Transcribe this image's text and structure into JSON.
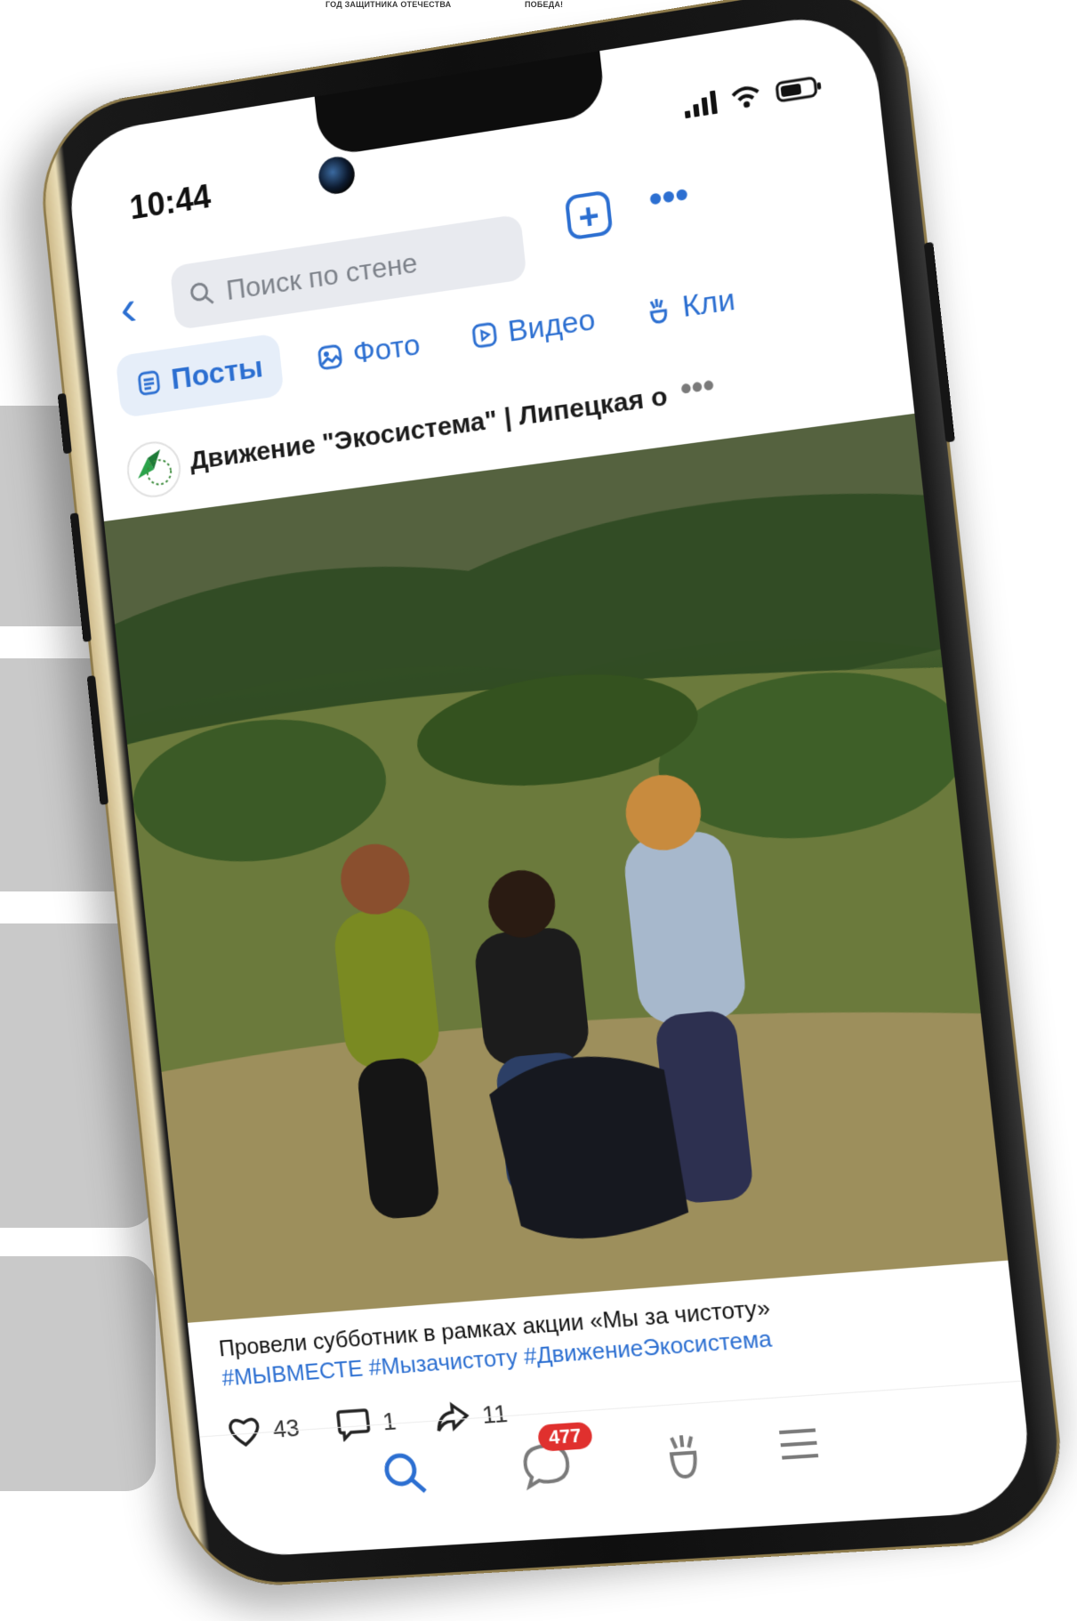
{
  "header_captions": {
    "left": "ГОД ЗАЩИТНИКА ОТЕЧЕСТВА",
    "right": "ПОБЕДА!"
  },
  "status_bar": {
    "time": "10:44"
  },
  "search": {
    "placeholder": "Поиск по стене"
  },
  "tabs": [
    {
      "label": "Посты",
      "active": true
    },
    {
      "label": "Фото",
      "active": false
    },
    {
      "label": "Видео",
      "active": false
    },
    {
      "label": "Кли",
      "active": false
    }
  ],
  "post": {
    "group_name": "Движение \"Экосистема\" | Липецкая о",
    "caption": "Провели субботник в рамках акции «Мы за чистоту»",
    "hashtags": "#МЫВМЕСТЕ #Мызачистоту #ДвижениеЭкосистема",
    "likes": "43",
    "comments": "1",
    "shares": "11"
  },
  "bottom_nav": {
    "messages_badge": "477"
  },
  "colors": {
    "accent": "#2c6fd1",
    "badge": "#e0302e",
    "side_panels": "#c9c9c9"
  },
  "icons": [
    "back-icon",
    "search-icon",
    "plus-icon",
    "more-icon",
    "posts-icon",
    "photo-icon",
    "video-icon",
    "clips-icon",
    "heart-icon",
    "comment-icon",
    "share-icon",
    "messages-icon",
    "menu-icon"
  ]
}
